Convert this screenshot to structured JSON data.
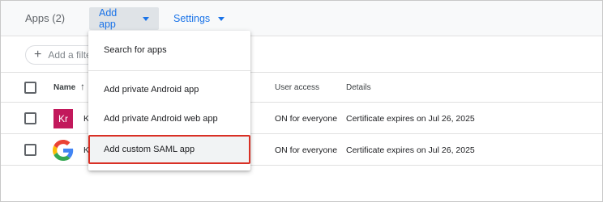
{
  "header": {
    "apps_title": "Apps (2)",
    "add_app_label": "Add app",
    "settings_label": "Settings"
  },
  "filter": {
    "add_filter_label": "Add a filter"
  },
  "table": {
    "columns": {
      "name": "Name",
      "user_access": "User access",
      "details": "Details"
    },
    "rows": [
      {
        "logo_text": "Kr",
        "name_partial": "K",
        "user_access": "ON for everyone",
        "details": "Certificate expires on Jul 26, 2025"
      },
      {
        "logo_text": "",
        "name_partial": "K",
        "user_access": "ON for everyone",
        "details": "Certificate expires on Jul 26, 2025"
      }
    ]
  },
  "add_app_menu": {
    "items": [
      {
        "label": "Search for apps"
      },
      {
        "label": "Add private Android app"
      },
      {
        "label": "Add private Android web app"
      },
      {
        "label": "Add custom SAML app",
        "highlighted": true
      }
    ]
  },
  "colors": {
    "accent": "#1a73e8",
    "highlight_border": "#d93025",
    "kr_logo_bg": "#c2185b"
  }
}
